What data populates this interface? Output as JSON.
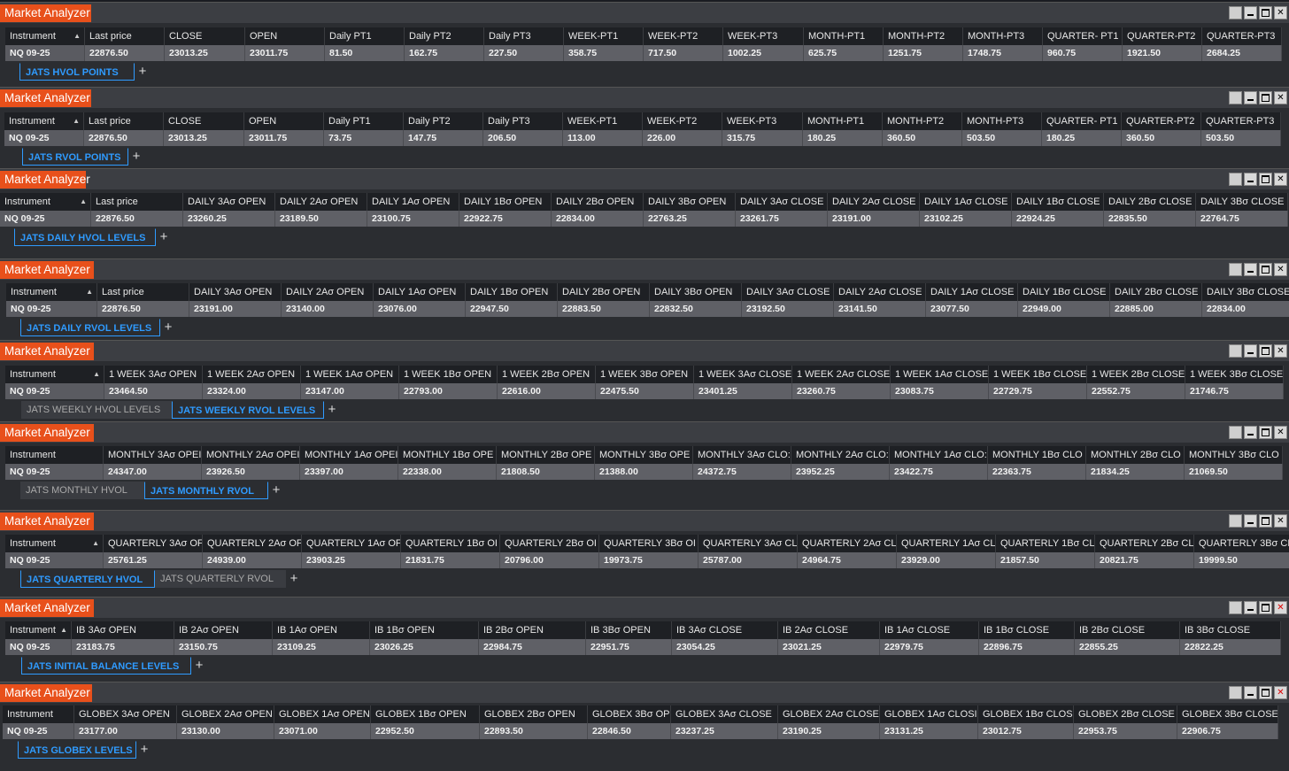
{
  "window_title": "Market Analyzer",
  "panels": [
    {
      "tabs": [
        {
          "label": "JATS HVOL POINTS",
          "active": true
        }
      ],
      "headers": [
        "Instrument",
        "Last price",
        "CLOSE",
        "OPEN",
        "Daily PT1",
        "Daily PT2",
        "Daily PT3",
        "WEEK-PT1",
        "WEEK-PT2",
        "WEEK-PT3",
        "MONTH-PT1",
        "MONTH-PT2",
        "MONTH-PT3",
        "QUARTER- PT1",
        "QUARTER-PT2",
        "QUARTER-PT3"
      ],
      "values": [
        "NQ 09-25",
        "22876.50",
        "23013.25",
        "23011.75",
        "81.50",
        "162.75",
        "227.50",
        "358.75",
        "717.50",
        "1002.25",
        "625.75",
        "1251.75",
        "1748.75",
        "960.75",
        "1921.50",
        "2684.25"
      ]
    },
    {
      "tabs": [
        {
          "label": "JATS RVOL POINTS",
          "active": true
        }
      ],
      "headers": [
        "Instrument",
        "Last price",
        "CLOSE",
        "OPEN",
        "Daily PT1",
        "Daily PT2",
        "Daily PT3",
        "WEEK-PT1",
        "WEEK-PT2",
        "WEEK-PT3",
        "MONTH-PT1",
        "MONTH-PT2",
        "MONTH-PT3",
        "QUARTER- PT1",
        "QUARTER-PT2",
        "QUARTER-PT3"
      ],
      "values": [
        "NQ 09-25",
        "22876.50",
        "23013.25",
        "23011.75",
        "73.75",
        "147.75",
        "206.50",
        "113.00",
        "226.00",
        "315.75",
        "180.25",
        "360.50",
        "503.50",
        "180.25",
        "360.50",
        "503.50"
      ]
    },
    {
      "tabs": [
        {
          "label": "JATS DAILY HVOL LEVELS",
          "active": true
        }
      ],
      "headers": [
        "Instrument",
        "Last price",
        "DAILY 3Aσ OPEN",
        "DAILY 2Aσ OPEN",
        "DAILY 1Aσ OPEN",
        "DAILY 1Bσ OPEN",
        "DAILY 2Bσ OPEN",
        "DAILY 3Bσ OPEN",
        "DAILY 3Aσ CLOSE",
        "DAILY 2Aσ CLOSE",
        "DAILY 1Aσ CLOSE",
        "DAILY 1Bσ CLOSE",
        "DAILY 2Bσ CLOSE",
        "DAILY 3Bσ CLOSE"
      ],
      "values": [
        "NQ 09-25",
        "22876.50",
        "23260.25",
        "23189.50",
        "23100.75",
        "22922.75",
        "22834.00",
        "22763.25",
        "23261.75",
        "23191.00",
        "23102.25",
        "22924.25",
        "22835.50",
        "22764.75"
      ]
    },
    {
      "tabs": [
        {
          "label": "JATS DAILY RVOL LEVELS",
          "active": true
        }
      ],
      "headers": [
        "Instrument",
        "Last price",
        "DAILY 3Aσ OPEN",
        "DAILY 2Aσ OPEN",
        "DAILY 1Aσ OPEN",
        "DAILY 1Bσ OPEN",
        "DAILY 2Bσ OPEN",
        "DAILY 3Bσ OPEN",
        "DAILY 3Aσ CLOSE",
        "DAILY 2Aσ CLOSE",
        "DAILY 1Aσ CLOSE",
        "DAILY 1Bσ CLOSE",
        "DAILY 2Bσ CLOSE",
        "DAILY 3Bσ CLOSE"
      ],
      "values": [
        "NQ 09-25",
        "22876.50",
        "23191.00",
        "23140.00",
        "23076.00",
        "22947.50",
        "22883.50",
        "22832.50",
        "23192.50",
        "23141.50",
        "23077.50",
        "22949.00",
        "22885.00",
        "22834.00"
      ]
    },
    {
      "tabs": [
        {
          "label": "JATS WEEKLY HVOL LEVELS",
          "active": false
        },
        {
          "label": "JATS WEEKLY RVOL LEVELS",
          "active": true
        }
      ],
      "headers": [
        "Instrument",
        "1 WEEK 3Aσ OPEN",
        "1 WEEK 2Aσ OPEN",
        "1 WEEK 1Aσ OPEN",
        "1 WEEK 1Bσ OPEN",
        "1 WEEK 2Bσ OPEN",
        "1 WEEK 3Bσ OPEN",
        "1 WEEK 3Aσ CLOSE",
        "1 WEEK 2Aσ CLOSE",
        "1 WEEK 1Aσ CLOSE",
        "1 WEEK 1Bσ CLOSE",
        "1 WEEK 2Bσ CLOSE",
        "1 WEEK 3Bσ CLOSE"
      ],
      "values": [
        "NQ 09-25",
        "23464.50",
        "23324.00",
        "23147.00",
        "22793.00",
        "22616.00",
        "22475.50",
        "23401.25",
        "23260.75",
        "23083.75",
        "22729.75",
        "22552.75",
        "21746.75"
      ]
    },
    {
      "tabs": [
        {
          "label": "JATS MONTHLY HVOL",
          "active": false
        },
        {
          "label": "JATS MONTHLY RVOL",
          "active": true
        }
      ],
      "headers": [
        "Instrument",
        "MONTHLY 3Aσ OPEI",
        "MONTHLY 2Aσ OPEI",
        "MONTHLY 1Aσ OPEI",
        "MONTHLY 1Bσ OPE",
        "MONTHLY 2Bσ OPE",
        "MONTHLY 3Bσ OPE",
        "MONTHLY 3Aσ CLO:",
        "MONTHLY 2Aσ CLO:",
        "MONTHLY 1Aσ CLO:",
        "MONTHLY 1Bσ CLO",
        "MONTHLY 2Bσ CLO",
        "MONTHLY 3Bσ CLO"
      ],
      "values": [
        "NQ 09-25",
        "24347.00",
        "23926.50",
        "23397.00",
        "22338.00",
        "21808.50",
        "21388.00",
        "24372.75",
        "23952.25",
        "23422.75",
        "22363.75",
        "21834.25",
        "21069.50"
      ]
    },
    {
      "tabs": [
        {
          "label": "JATS QUARTERLY HVOL",
          "active": true
        },
        {
          "label": "JATS QUARTERLY RVOL",
          "active": false
        }
      ],
      "headers": [
        "Instrument",
        "QUARTERLY 3Aσ OF",
        "QUARTERLY 2Aσ OF",
        "QUARTERLY 1Aσ OF",
        "QUARTERLY 1Bσ OI",
        "QUARTERLY 2Bσ OI",
        "QUARTERLY 3Bσ OI",
        "QUARTERLY 3Aσ CL",
        "QUARTERLY 2Aσ CL",
        "QUARTERLY 1Aσ CL",
        "QUARTERLY 1Bσ CL",
        "QUARTERLY 2Bσ CL",
        "QUARTERLY 3Bσ CL"
      ],
      "values": [
        "NQ 09-25",
        "25761.25",
        "24939.00",
        "23903.25",
        "21831.75",
        "20796.00",
        "19973.75",
        "25787.00",
        "24964.75",
        "23929.00",
        "21857.50",
        "20821.75",
        "19999.50"
      ]
    },
    {
      "tabs": [
        {
          "label": "JATS INITIAL BALANCE LEVELS",
          "active": true
        }
      ],
      "headers": [
        "Instrument",
        "IB 3Aσ OPEN",
        "IB 2Aσ OPEN",
        "IB 1Aσ OPEN",
        "IB 1Bσ OPEN",
        "IB 2Bσ OPEN",
        "IB 3Bσ OPEN",
        "IB 3Aσ CLOSE",
        "IB 2Aσ CLOSE",
        "IB 1Aσ CLOSE",
        "IB 1Bσ CLOSE",
        "IB 2Bσ CLOSE",
        "IB 3Bσ CLOSE"
      ],
      "values": [
        "NQ 09-25",
        "23183.75",
        "23150.75",
        "23109.25",
        "23026.25",
        "22984.75",
        "22951.75",
        "23054.25",
        "23021.25",
        "22979.75",
        "22896.75",
        "22855.25",
        "22822.25"
      ]
    },
    {
      "tabs": [
        {
          "label": "JATS GLOBEX LEVELS",
          "active": true
        }
      ],
      "headers": [
        "Instrument",
        "GLOBEX 3Aσ OPEN",
        "GLOBEX 2Aσ OPEN",
        "GLOBEX 1Aσ OPEN",
        "GLOBEX 1Bσ OPEN",
        "GLOBEX 2Bσ OPEN",
        "GLOBEX 3Bσ OP",
        "GLOBEX 3Aσ CLOSE",
        "GLOBEX 2Aσ CLOSE",
        "GLOBEX 1Aσ CLOSI",
        "GLOBEX 1Bσ CLOS",
        "GLOBEX 2Bσ CLOSE",
        "GLOBEX 3Bσ CLOSE"
      ],
      "values": [
        "NQ 09-25",
        "23177.00",
        "23130.00",
        "23071.00",
        "22952.50",
        "22893.50",
        "22846.50",
        "23237.25",
        "23190.25",
        "23131.25",
        "23012.75",
        "22953.75",
        "22906.75"
      ]
    }
  ],
  "add_tab_label": "+",
  "close_glyph": "✕"
}
